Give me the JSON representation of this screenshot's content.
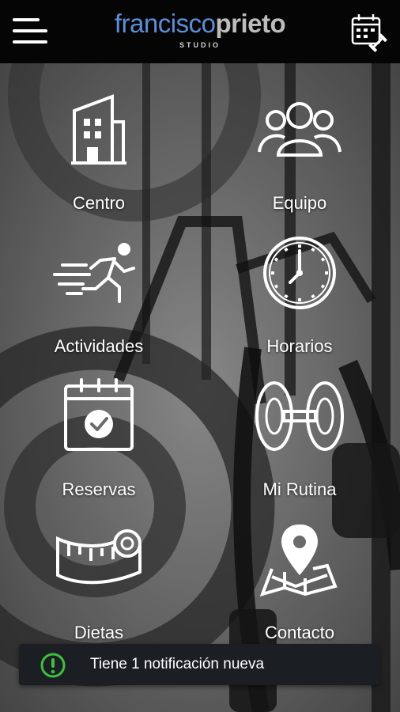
{
  "header": {
    "logo_light": "francisco",
    "logo_bold": "prieto",
    "logo_sub": "STUDIO"
  },
  "menu": [
    {
      "label": "Centro",
      "icon": "building-icon"
    },
    {
      "label": "Equipo",
      "icon": "team-icon"
    },
    {
      "label": "Actividades",
      "icon": "running-icon"
    },
    {
      "label": "Horarios",
      "icon": "clock-icon"
    },
    {
      "label": "Reservas",
      "icon": "calendar-check-icon"
    },
    {
      "label": "Mi Rutina",
      "icon": "dumbbell-icon"
    },
    {
      "label": "Dietas",
      "icon": "measuring-tape-icon"
    },
    {
      "label": "Contacto",
      "icon": "map-pin-icon"
    }
  ],
  "notification": {
    "text": "Tiene 1 notificación nueva",
    "icon": "alert-circle-icon",
    "icon_color": "#3fbf3f"
  },
  "colors": {
    "topbar": "#050505",
    "logo_accent": "#5d8ed6"
  }
}
